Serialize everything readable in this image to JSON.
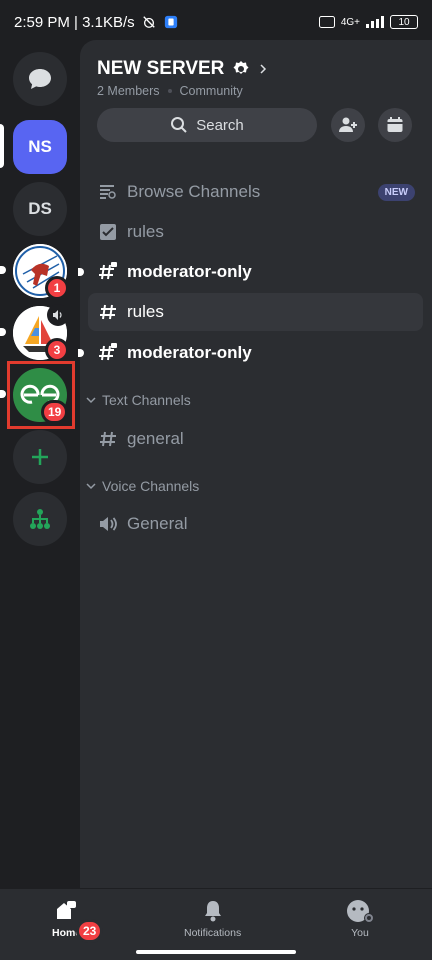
{
  "status_bar": {
    "time_speed": "2:59 PM | 3.1KB/s",
    "network": "4G+",
    "battery": "10"
  },
  "rail": {
    "dm_icon": "chat-bubble-icon",
    "servers": [
      {
        "id": "ns",
        "label": "NS",
        "active": true
      },
      {
        "id": "ds",
        "label": "DS"
      },
      {
        "id": "spider",
        "badge": "1"
      },
      {
        "id": "boat",
        "badge": "3"
      },
      {
        "id": "gfg",
        "logo": "GfG",
        "badge": "19"
      }
    ],
    "add_icon": "plus-icon",
    "discover_icon": "hub-icon"
  },
  "server": {
    "name": "NEW SERVER",
    "members": "2 Members",
    "type": "Community",
    "search_label": "Search"
  },
  "channels": {
    "browse": {
      "label": "Browse Channels",
      "badge": "NEW"
    },
    "rules_top": "rules",
    "mod1": "moderator-only",
    "rules": "rules",
    "mod2": "moderator-only",
    "text_category": "Text Channels",
    "general": "general",
    "voice_category": "Voice Channels",
    "voice_general": "General"
  },
  "bottom_nav": {
    "home": "Home",
    "home_badge": "23",
    "notifications": "Notifications",
    "you": "You"
  },
  "colors": {
    "accent": "#5865f2",
    "badge": "#f23f43",
    "highlight": "#e23b2e",
    "green": "#23a55a"
  }
}
